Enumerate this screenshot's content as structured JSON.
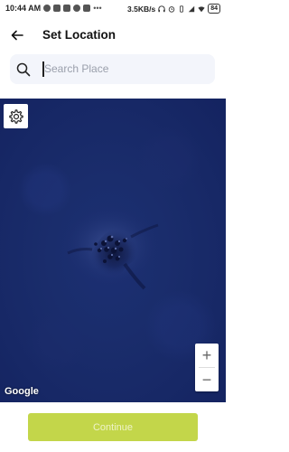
{
  "status_bar": {
    "time": "10:44 AM",
    "speed": "3.5KB/s",
    "battery": "84"
  },
  "header": {
    "title": "Set Location"
  },
  "search": {
    "placeholder": "Search Place",
    "value": ""
  },
  "map": {
    "attribution": "Google",
    "zoom_in": "+",
    "zoom_out": "−"
  },
  "footer": {
    "continue_label": "Continue"
  },
  "colors": {
    "accent": "#c3d64a",
    "map_ocean": "#1a2d6c",
    "search_bg": "#f3f5fb"
  }
}
